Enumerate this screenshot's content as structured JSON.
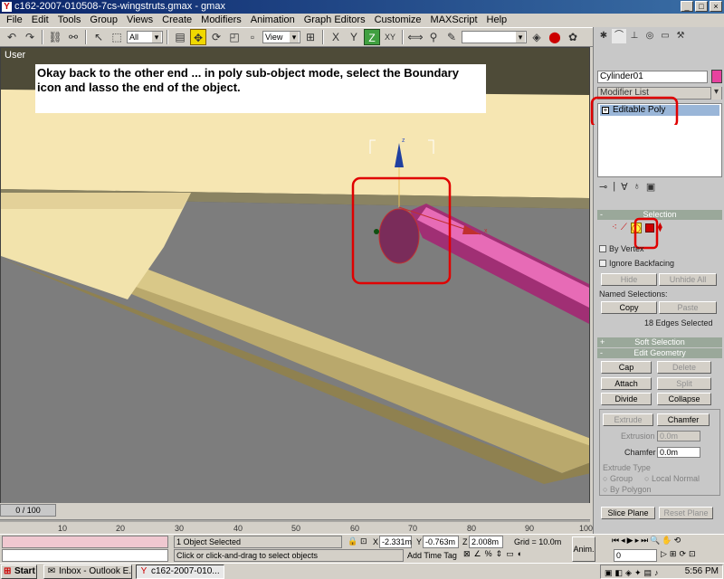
{
  "window": {
    "title": "c162-2007-010508-7cs-wingstruts.gmax - gmax",
    "app_icon": "gmax-logo-icon",
    "buttons": [
      "_",
      "□",
      "×"
    ]
  },
  "menu": [
    "File",
    "Edit",
    "Tools",
    "Group",
    "Views",
    "Create",
    "Modifiers",
    "Animation",
    "Graph Editors",
    "Customize",
    "MAXScript",
    "Help"
  ],
  "toolbar": {
    "selection_filter": "All",
    "reference_coord": "View",
    "named_selection": ""
  },
  "viewport": {
    "label": "User",
    "instruction": "Okay back to the other end ...  in poly sub-object mode, select the Boundary icon and lasso the end of the object.",
    "gizmo_z_label": "z",
    "gizmo_x_label": "x"
  },
  "timeline": {
    "frame_display": "0 / 100",
    "ticks": [
      "10",
      "20",
      "30",
      "40",
      "50",
      "60",
      "70",
      "80",
      "90",
      "100"
    ]
  },
  "command_panel": {
    "object_name": "Cylinder01",
    "object_color": "#e7429f",
    "modifier_list": "Modifier List",
    "stack_item": "Editable Poly",
    "selection": {
      "title": "Selection",
      "by_vertex": "By Vertex",
      "ignore_backfacing": "Ignore Backfacing",
      "hide": "Hide",
      "unhide_all": "Unhide All",
      "named_selections": "Named Selections:",
      "copy": "Copy",
      "paste": "Paste",
      "status": "18 Edges Selected"
    },
    "soft_selection": {
      "title": "Soft Selection"
    },
    "edit_geometry": {
      "title": "Edit Geometry",
      "cap": "Cap",
      "delete": "Delete",
      "attach": "Attach",
      "split": "Split",
      "divide": "Divide",
      "collapse": "Collapse",
      "extrude": "Extrude",
      "chamfer": "Chamfer",
      "extrusion_label": "Extrusion",
      "extrusion_value": "0.0m",
      "chamfer_label": "Chamfer",
      "chamfer_value": "0.0m",
      "extrude_type": "Extrude Type",
      "group": "Group",
      "local_normal": "Local Normal",
      "by_polygon": "By Polygon",
      "slice_plane": "Slice Plane",
      "reset_plane": "Reset Plane"
    }
  },
  "status_bar": {
    "selected": "1 Object Selected",
    "prompt": "Click or click-and-drag to select objects",
    "x_label": "X",
    "x_value": "-2.331m",
    "y_label": "Y",
    "y_value": "-0.763m",
    "z_label": "Z",
    "z_value": "2.008m",
    "grid": "Grid = 10.0m",
    "add_time_tag": "Add Time Tag",
    "anim": "Anim.",
    "frame_value": "0"
  },
  "taskbar": {
    "start": "Start",
    "tasks": [
      "Inbox - Outlook E...",
      "c162-2007-010..."
    ],
    "clock": "5:56 PM"
  }
}
